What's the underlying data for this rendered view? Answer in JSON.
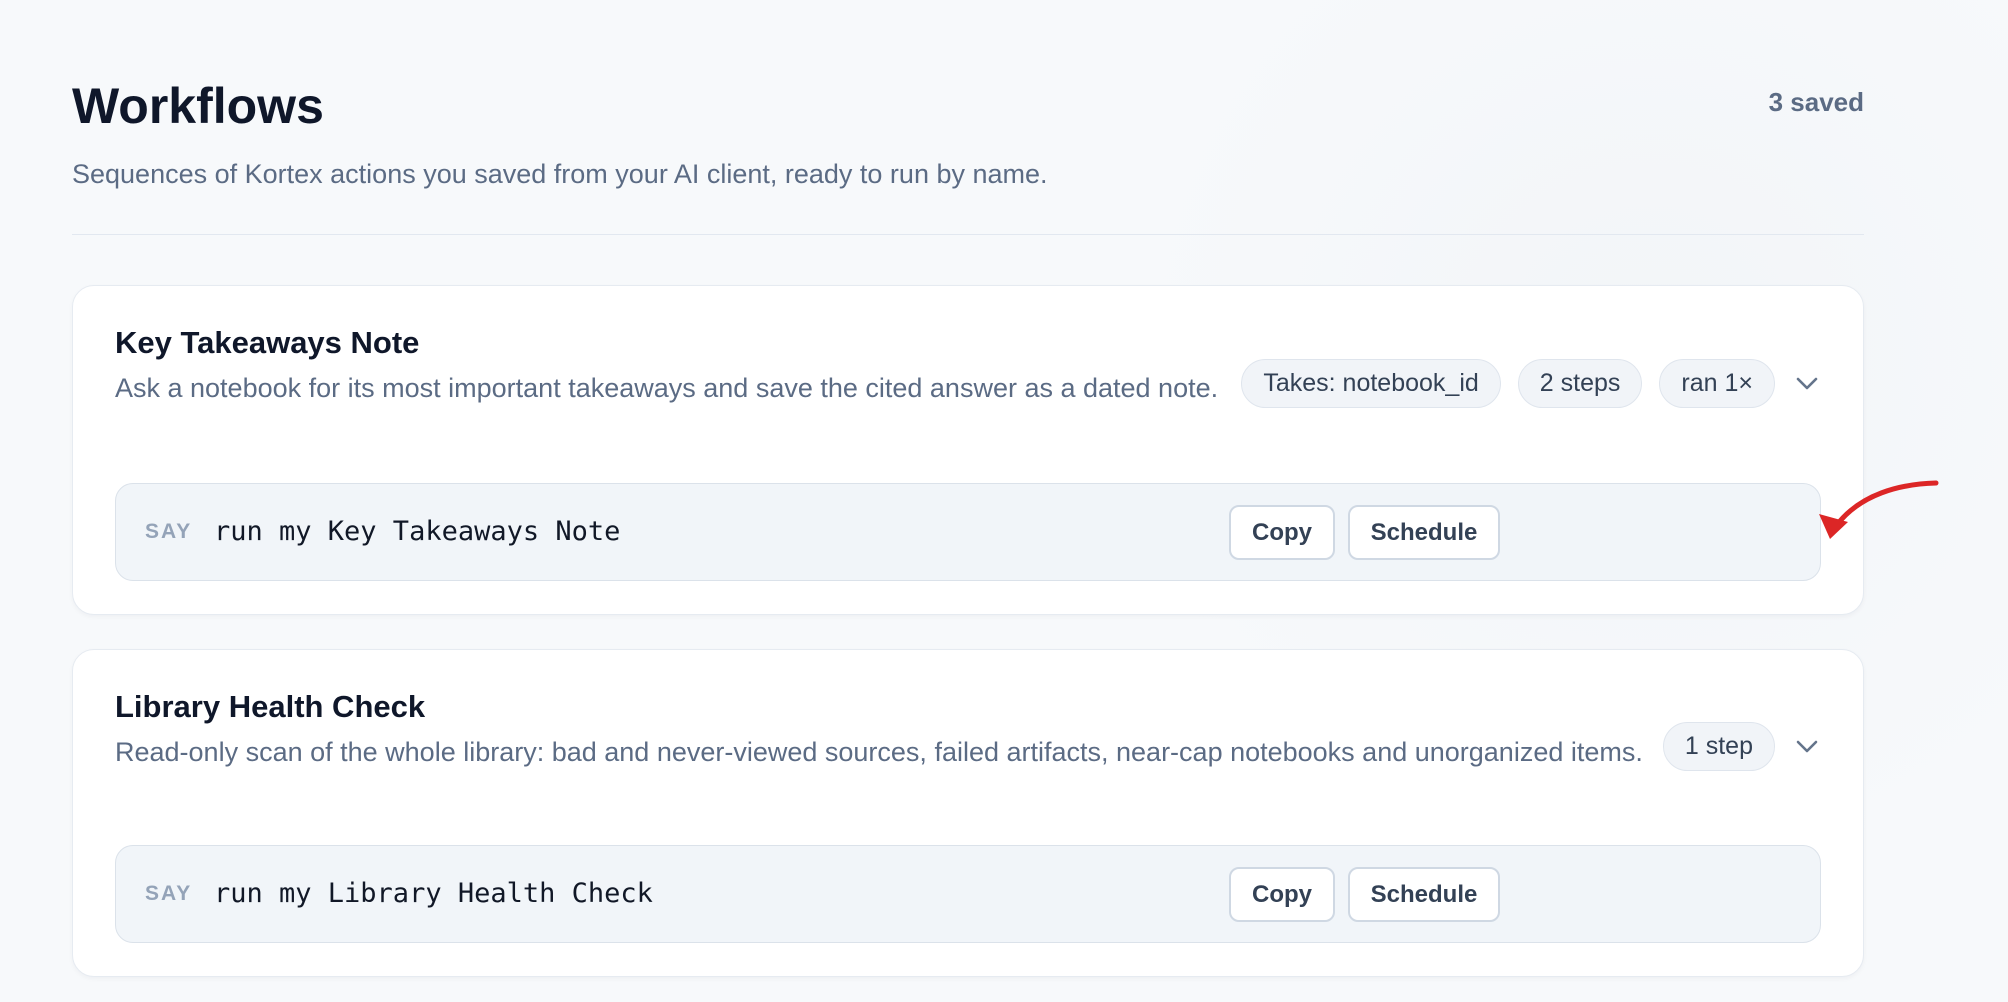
{
  "header": {
    "title": "Workflows",
    "subtitle": "Sequences of Kortex actions you saved from your AI client, ready to run by name.",
    "saved_count": "3 saved"
  },
  "workflows": [
    {
      "title": "Key Takeaways Note",
      "description": "Ask a notebook for its most important takeaways and save the cited answer as a dated note.",
      "chips": [
        "Takes: notebook_id",
        "2 steps",
        "ran 1×"
      ],
      "say_label": "SAY",
      "command": "run my Key Takeaways Note",
      "copy_label": "Copy",
      "schedule_label": "Schedule"
    },
    {
      "title": "Library Health Check",
      "description": "Read-only scan of the whole library: bad and never-viewed sources, failed artifacts, near-cap notebooks and unorganized items.",
      "chips": [
        "1 step"
      ],
      "say_label": "SAY",
      "command": "run my Library Health Check",
      "copy_label": "Copy",
      "schedule_label": "Schedule"
    }
  ],
  "icons": {
    "expand": "chevron-down-icon",
    "annotation": "red-arrow-icon"
  },
  "colors": {
    "annotation_arrow": "#dc2626",
    "muted_text": "#5b6b84"
  }
}
